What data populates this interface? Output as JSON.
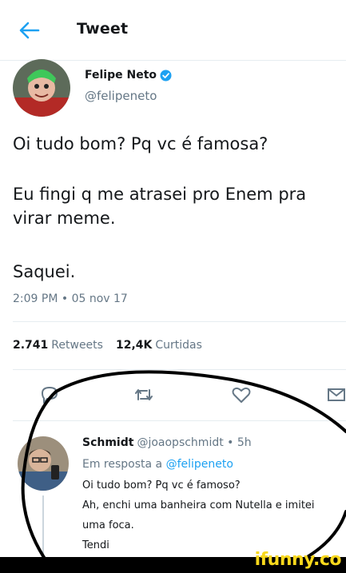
{
  "header": {
    "title": "Tweet",
    "back_icon": "arrow-left-icon"
  },
  "tweet": {
    "author_name": "Felipe Neto",
    "author_handle": "@felipeneto",
    "text_lines": [
      "Oi tudo bom? Pq vc é famosa?",
      "Eu fingi q me atrasei pro Enem pra",
      "virar meme.",
      "Saquei."
    ],
    "timestamp": "2:09 PM • 05 nov 17",
    "retweets_count": "2.741",
    "retweets_label": "Retweets",
    "likes_count": "12,4K",
    "likes_label": "Curtidas"
  },
  "actions": [
    "reply-icon",
    "retweet-icon",
    "like-icon",
    "message-icon"
  ],
  "reply": {
    "name": "Schmidt",
    "handle_time": "@joaopschmidt • 5h",
    "in_reply_prefix": "Em resposta a",
    "in_reply_mention": "@felipeneto",
    "lines": [
      "Oi tudo bom? Pq vc é famoso?",
      "Ah, enchi uma banheira com Nutella e imitei",
      "uma foca.",
      "Tendi"
    ]
  },
  "watermark": "ifunny.co",
  "colors": {
    "accent": "#1da1f2",
    "muted": "#657786",
    "text": "#14171a",
    "watermark": "#f8d81c"
  }
}
